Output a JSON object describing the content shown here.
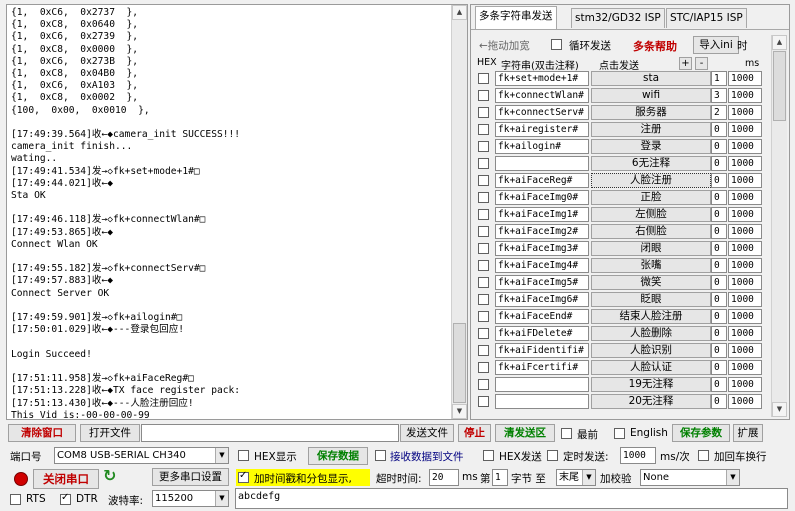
{
  "receive_text": "{1,  0xC6,  0x2737  },\n{1,  0xC8,  0x0640  },\n{1,  0xC6,  0x2739  },\n{1,  0xC8,  0x0000  },\n{1,  0xC6,  0x273B  },\n{1,  0xC8,  0x04B0  },\n{1,  0xC6,  0xA103  },\n{1,  0xC8,  0x0002  },\n{100,  0x00,  0x0010  },\n\n[17:49:39.564]收←◆camera_init SUCCESS!!!\ncamera_init finish...\nwating..\n[17:49:41.534]发→◇fk+set+mode+1#□\n[17:49:44.021]收←◆\nSta OK\n\n[17:49:46.118]发→◇fk+connectWlan#□\n[17:49:53.865]收←◆\nConnect Wlan OK\n\n[17:49:55.182]发→◇fk+connectServ#□\n[17:49:57.883]收←◆\nConnect Server OK\n\n[17:49:59.901]发→◇fk+ailogin#□\n[17:50:01.029]收←◆---登录包回应!\n\nLogin Succeed!\n\n[17:51:11.958]发→◇fk+aiFaceReg#□\n[17:51:13.228]收←◆TX face register pack:\n[17:51:13.430]收←◆---人脸注册回应!\nThis Vid is:-00-00-00-99",
  "tabs": [
    "多条字符串发送",
    "stm32/GD32 ISP",
    "STC/IAP15 ISP"
  ],
  "multi_toolbar": {
    "drag_label": "←拖动加宽",
    "loop_label": "循环发送",
    "help_label": "多条帮助",
    "import_label": "导入ini",
    "time_label": "时"
  },
  "col_headers": {
    "hex": "HEX",
    "str": "字符串(双击注释)",
    "click": "点击发送",
    "plus": "+",
    "minus": "-",
    "ms": "ms"
  },
  "rows": [
    {
      "cmd": "fk+set+mode+1#",
      "label": "sta",
      "num": "1",
      "delay": "1000"
    },
    {
      "cmd": "fk+connectWlan#",
      "label": "wifi",
      "num": "3",
      "delay": "1000"
    },
    {
      "cmd": "fk+connectServ#",
      "label": "服务器",
      "num": "2",
      "delay": "1000"
    },
    {
      "cmd": "fk+airegister#",
      "label": "注册",
      "num": "0",
      "delay": "1000"
    },
    {
      "cmd": "fk+ailogin#",
      "label": "登录",
      "num": "0",
      "delay": "1000"
    },
    {
      "cmd": "",
      "label": "6无注释",
      "num": "0",
      "delay": "1000"
    },
    {
      "cmd": "fk+aiFaceReg#",
      "label": "人脸注册",
      "num": "0",
      "delay": "1000"
    },
    {
      "cmd": "fk+aiFaceImg0#",
      "label": "正脸",
      "num": "0",
      "delay": "1000"
    },
    {
      "cmd": "fk+aiFaceImg1#",
      "label": "左侧脸",
      "num": "0",
      "delay": "1000"
    },
    {
      "cmd": "fk+aiFaceImg2#",
      "label": "右侧脸",
      "num": "0",
      "delay": "1000"
    },
    {
      "cmd": "fk+aiFaceImg3#",
      "label": "闭眼",
      "num": "0",
      "delay": "1000"
    },
    {
      "cmd": "fk+aiFaceImg4#",
      "label": "张嘴",
      "num": "0",
      "delay": "1000"
    },
    {
      "cmd": "fk+aiFaceImg5#",
      "label": "微笑",
      "num": "0",
      "delay": "1000"
    },
    {
      "cmd": "fk+aiFaceImg6#",
      "label": "眨眼",
      "num": "0",
      "delay": "1000"
    },
    {
      "cmd": "fk+aiFaceEnd#",
      "label": "结束人脸注册",
      "num": "0",
      "delay": "1000"
    },
    {
      "cmd": "fk+aiFDelete#",
      "label": "人脸删除",
      "num": "0",
      "delay": "1000"
    },
    {
      "cmd": "fk+aiFidentifi#",
      "label": "人脸识别",
      "num": "0",
      "delay": "1000"
    },
    {
      "cmd": "fk+aiFcertifi#",
      "label": "人脸认证",
      "num": "0",
      "delay": "1000"
    },
    {
      "cmd": "",
      "label": "19无注释",
      "num": "0",
      "delay": "1000"
    },
    {
      "cmd": "",
      "label": "20无注释",
      "num": "0",
      "delay": "1000"
    }
  ],
  "toolbar1": {
    "clear_window": "清除窗口",
    "open_file": "打开文件",
    "send_file": "发送文件",
    "stop": "停止",
    "clear_send": "清发送区",
    "topmost": "最前",
    "english": "English",
    "save_params": "保存参数",
    "expand": "扩展"
  },
  "toolbar2": {
    "port_label": "端口号",
    "port_value": "COM8 USB-SERIAL CH340",
    "hex_display": "HEX显示",
    "save_data": "保存数据",
    "recv_to_file": "接收数据到文件",
    "hex_send": "HEX发送",
    "timed_send": "定时发送:",
    "timed_value": "1000",
    "timed_unit": "ms/次",
    "add_crlf": "加回车换行"
  },
  "toolbar3": {
    "close_port": "关闭串口",
    "more_settings": "更多串口设置",
    "timestamp_label": "加时间戳和分包显示,",
    "timeout_label": "超时时间:",
    "timeout_value": "20",
    "timeout_unit": "ms",
    "byte_prefix": "第",
    "byte_value": "1",
    "byte_suffix": "字节 至",
    "tail_value": "末尾",
    "checksum_label": "加校验",
    "checksum_value": "None"
  },
  "toolbar4": {
    "rts": "RTS",
    "dtr": "DTR",
    "baud_label": "波特率:",
    "baud_value": "115200"
  },
  "send_text": "abcdefg",
  "colors": {
    "red": "#c00000",
    "green": "#008000",
    "highlight": "#ffff00"
  }
}
